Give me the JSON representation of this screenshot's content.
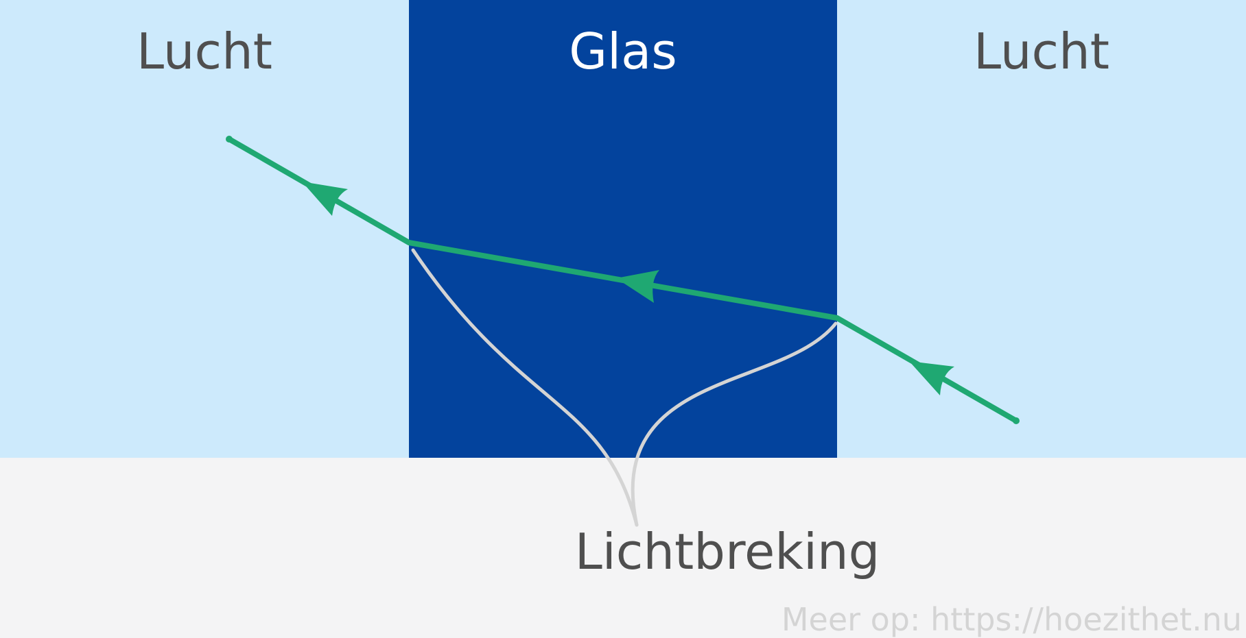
{
  "colors": {
    "air": "#cdeafc",
    "glass": "#03439d",
    "bottom": "#f4f4f5",
    "ray": "#1fa872",
    "callout": "#d4d4d4",
    "dark_text": "#4f4f4f",
    "light_text": "#ffffff",
    "watermark": "#d4d4d4"
  },
  "labels": {
    "air_left": "Lucht",
    "glass": "Glas",
    "air_right": "Lucht",
    "caption": "Lichtbreking",
    "watermark": "Meer op: https://hoezithet.nu"
  }
}
